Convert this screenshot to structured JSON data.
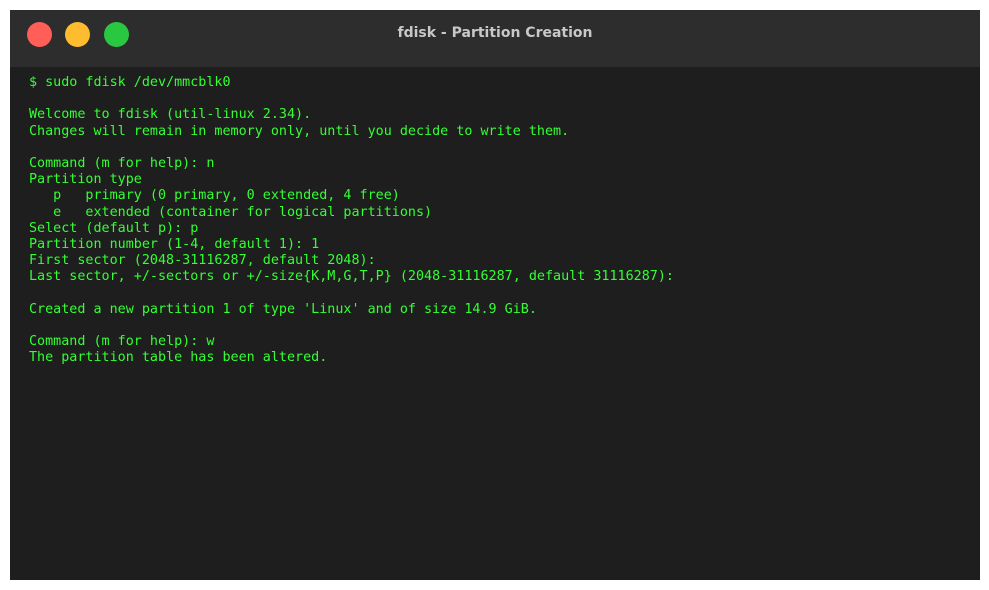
{
  "window": {
    "title": "fdisk - Partition Creation",
    "controls": {
      "close_color": "#ff5f57",
      "minimize_color": "#febc2e",
      "maximize_color": "#28c840"
    }
  },
  "terminal": {
    "text_color": "#33ff33",
    "background": "#1e1e1e",
    "lines": [
      "$ sudo fdisk /dev/mmcblk0",
      "",
      "Welcome to fdisk (util-linux 2.34).",
      "Changes will remain in memory only, until you decide to write them.",
      "",
      "Command (m for help): n",
      "Partition type",
      "   p   primary (0 primary, 0 extended, 4 free)",
      "   e   extended (container for logical partitions)",
      "Select (default p): p",
      "Partition number (1-4, default 1): 1",
      "First sector (2048-31116287, default 2048):",
      "Last sector, +/-sectors or +/-size{K,M,G,T,P} (2048-31116287, default 31116287):",
      "",
      "Created a new partition 1 of type 'Linux' and of size 14.9 GiB.",
      "",
      "Command (m for help): w",
      "The partition table has been altered."
    ]
  }
}
